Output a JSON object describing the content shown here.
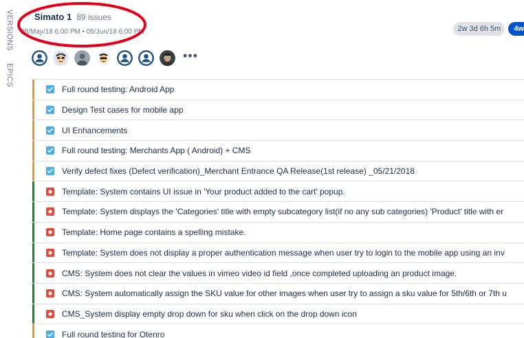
{
  "sidebar_tabs": {
    "versions": "VERSIONS",
    "epics": "EPICS"
  },
  "sprint": {
    "name": "Simato 1",
    "issue_count": "89 issues",
    "dates": "28/May/18 6:00 PM • 05/Jun/18 6:00 PM",
    "remaining_time": "2w 3d 6h 5m",
    "estimate_badge": "4w"
  },
  "colors": {
    "task_stripe": "#f79232",
    "bug_stripe": "#14892c",
    "task_icon": "#4bade8",
    "bug_icon": "#e5493a",
    "annotation": "#e3001b"
  },
  "avatars": [
    "default-user-icon",
    "cartoon-face-icon",
    "photo-avatar",
    "cartoon-face-icon",
    "default-user-icon",
    "default-user-icon",
    "photo-avatar"
  ],
  "more_label": "•••",
  "issues": [
    {
      "type": "task",
      "summary": "Full round testing: Android App"
    },
    {
      "type": "task",
      "summary": "Design Test cases for mobile app"
    },
    {
      "type": "task",
      "summary": "UI Enhancements"
    },
    {
      "type": "task",
      "summary": "Full round testing: Merchants App ( Android) + CMS"
    },
    {
      "type": "task",
      "summary": "Verify defect fixes (Defect verification)_Merchant Entrance QA Release(1st release) _05/21/2018"
    },
    {
      "type": "bug",
      "summary": "Template: System contains UI issue in 'Your product added to the cart' popup."
    },
    {
      "type": "bug",
      "summary": "Template: System displays the 'Categories' title with empty subcategory list(if no any sub categories) 'Product' title with er"
    },
    {
      "type": "bug",
      "summary": "Template: Home page contains a spelling mistake."
    },
    {
      "type": "bug",
      "summary": "Template: System does not display a proper authentication message when user try to login to the mobile app using an inv"
    },
    {
      "type": "bug",
      "summary": "CMS: System does not clear the values in vimeo video id field ,once completed uploading an product image."
    },
    {
      "type": "bug",
      "summary": "CMS: System automatically assign the SKU value for other images when user try to assign a sku value for 5th/6th or 7th u"
    },
    {
      "type": "bug",
      "summary": "CMS_System display empty drop down for sku when click on the drop down icon"
    },
    {
      "type": "task",
      "summary": "Full round testing for Otenro"
    }
  ]
}
